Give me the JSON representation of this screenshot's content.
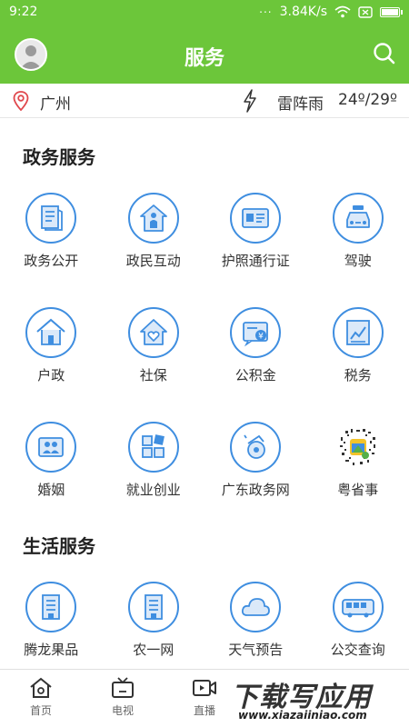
{
  "status_bar": {
    "time": "9:22",
    "dots": "...",
    "speed": "3.84K/s",
    "battery_level": 0.9
  },
  "header": {
    "title": "服务",
    "avatar_icon": "avatar-icon",
    "search_icon": "search-icon"
  },
  "weather": {
    "city": "广州",
    "condition": "雷阵雨",
    "temperature": "24º/29º"
  },
  "sections": {
    "gov_title": "政务服务",
    "life_title": "生活服务"
  },
  "gov_services": [
    {
      "label": "政务公开",
      "icon": "document-icon"
    },
    {
      "label": "政民互动",
      "icon": "person-house-icon"
    },
    {
      "label": "护照通行证",
      "icon": "id-card-icon"
    },
    {
      "label": "驾驶",
      "icon": "car-icon"
    },
    {
      "label": "户政",
      "icon": "house-icon"
    },
    {
      "label": "社保",
      "icon": "heart-house-icon"
    },
    {
      "label": "公积金",
      "icon": "yuan-icon"
    },
    {
      "label": "税务",
      "icon": "tax-chart-icon"
    },
    {
      "label": "婚姻",
      "icon": "couple-icon"
    },
    {
      "label": "就业创业",
      "icon": "blocks-icon"
    },
    {
      "label": "广东政务网",
      "icon": "whistle-icon"
    },
    {
      "label": "粤省事",
      "icon": "qr-code-icon"
    }
  ],
  "life_services": [
    {
      "label": "腾龙果品",
      "icon": "building-icon"
    },
    {
      "label": "农一网",
      "icon": "building-icon"
    },
    {
      "label": "天气预告",
      "icon": "cloud-icon"
    },
    {
      "label": "公交查询",
      "icon": "bus-icon"
    }
  ],
  "bottom_nav": [
    {
      "label": "首页",
      "icon": "home-icon"
    },
    {
      "label": "电视",
      "icon": "tv-icon"
    },
    {
      "label": "直播",
      "icon": "live-video-icon"
    }
  ],
  "watermark": {
    "main": "下载写应用",
    "url": "www.xiazaiiniao.com"
  },
  "colors": {
    "accent": "#6cc63a",
    "icon_blue": "#3f8ee0"
  }
}
